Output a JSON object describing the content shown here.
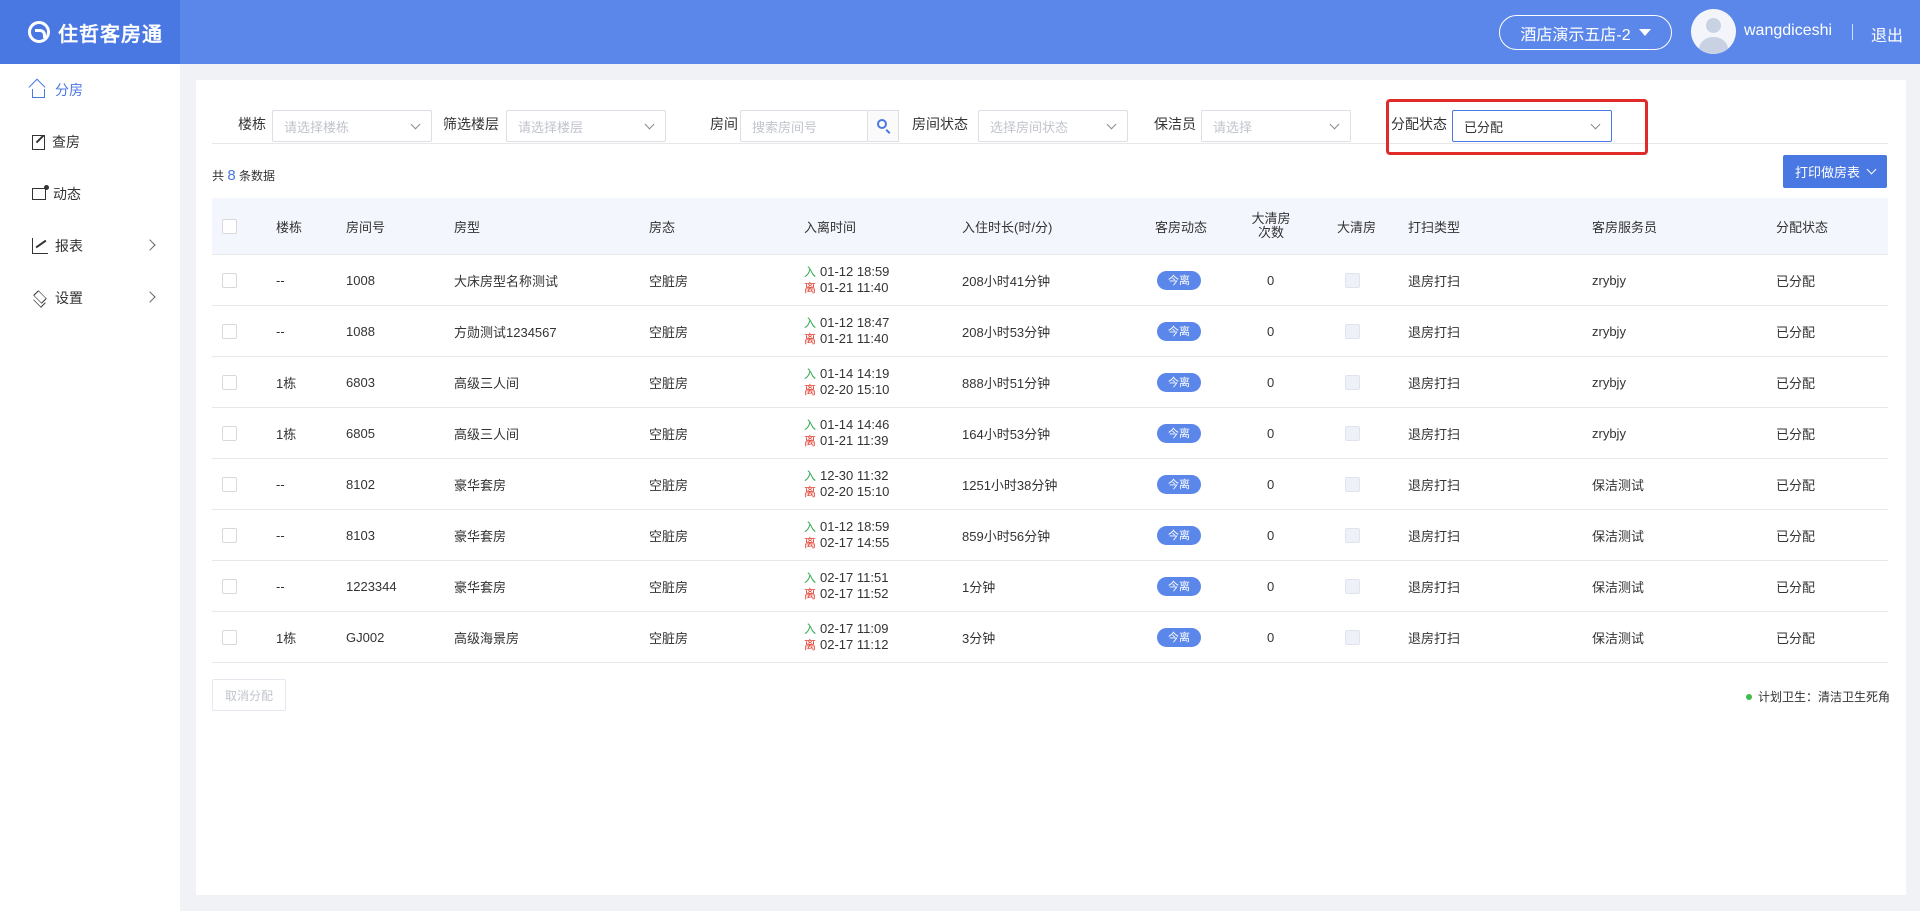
{
  "app": {
    "title": "住哲客房通"
  },
  "header": {
    "store": "酒店演示五店-2",
    "username": "wangdiceshi",
    "logout": "退出"
  },
  "sidebar": {
    "items": [
      {
        "label": "分房",
        "icon": "home-icon",
        "active": true
      },
      {
        "label": "查房",
        "icon": "edit-icon"
      },
      {
        "label": "动态",
        "icon": "dynamic-icon"
      },
      {
        "label": "报表",
        "icon": "chart-icon",
        "has_children": true
      },
      {
        "label": "设置",
        "icon": "layers-icon",
        "has_children": true
      }
    ]
  },
  "filters": {
    "building": {
      "label": "楼栋",
      "placeholder": "请选择楼栋"
    },
    "floor": {
      "label": "筛选楼层",
      "placeholder": "请选择楼层"
    },
    "room": {
      "label": "房间",
      "placeholder": "搜索房间号"
    },
    "room_status": {
      "label": "房间状态",
      "placeholder": "选择房间状态"
    },
    "cleaner": {
      "label": "保洁员",
      "placeholder": "请选择"
    },
    "assign_status": {
      "label": "分配状态",
      "value": "已分配"
    }
  },
  "summary": {
    "prefix": "共",
    "count": "8",
    "suffix": "条数据"
  },
  "toolbar": {
    "print_label": "打印做房表"
  },
  "table": {
    "columns": {
      "building": "楼栋",
      "room_no": "房间号",
      "room_type": "房型",
      "status": "房态",
      "time": "入离时间",
      "duration": "入住时长(时/分)",
      "dynamic": "客房动态",
      "clean_count_1": "大清房",
      "clean_count_2": "次数",
      "deep_clean": "大清房",
      "clean_type": "打扫类型",
      "attendant": "客房服务员",
      "assign": "分配状态"
    },
    "in_label": "入",
    "out_label": "离",
    "rows": [
      {
        "building": "--",
        "room_no": "1008",
        "room_type": "大床房型名称测试",
        "status": "空脏房",
        "in": "01-12 18:59",
        "out": "01-21 11:40",
        "duration": "208小时41分钟",
        "dynamic": "今离",
        "clean_count": "0",
        "clean_type": "退房打扫",
        "attendant": "zrybjy",
        "assign": "已分配"
      },
      {
        "building": "--",
        "room_no": "1088",
        "room_type": "方勋测试1234567",
        "status": "空脏房",
        "in": "01-12 18:47",
        "out": "01-21 11:40",
        "duration": "208小时53分钟",
        "dynamic": "今离",
        "clean_count": "0",
        "clean_type": "退房打扫",
        "attendant": "zrybjy",
        "assign": "已分配"
      },
      {
        "building": "1栋",
        "room_no": "6803",
        "room_type": "高级三人间",
        "status": "空脏房",
        "in": "01-14 14:19",
        "out": "02-20 15:10",
        "duration": "888小时51分钟",
        "dynamic": "今离",
        "clean_count": "0",
        "clean_type": "退房打扫",
        "attendant": "zrybjy",
        "assign": "已分配"
      },
      {
        "building": "1栋",
        "room_no": "6805",
        "room_type": "高级三人间",
        "status": "空脏房",
        "in": "01-14 14:46",
        "out": "01-21 11:39",
        "duration": "164小时53分钟",
        "dynamic": "今离",
        "clean_count": "0",
        "clean_type": "退房打扫",
        "attendant": "zrybjy",
        "assign": "已分配"
      },
      {
        "building": "--",
        "room_no": "8102",
        "room_type": "豪华套房",
        "status": "空脏房",
        "in": "12-30 11:32",
        "out": "02-20 15:10",
        "duration": "1251小时38分钟",
        "dynamic": "今离",
        "clean_count": "0",
        "clean_type": "退房打扫",
        "attendant": "保洁测试",
        "assign": "已分配"
      },
      {
        "building": "--",
        "room_no": "8103",
        "room_type": "豪华套房",
        "status": "空脏房",
        "in": "01-12 18:59",
        "out": "02-17 14:55",
        "duration": "859小时56分钟",
        "dynamic": "今离",
        "clean_count": "0",
        "clean_type": "退房打扫",
        "attendant": "保洁测试",
        "assign": "已分配"
      },
      {
        "building": "--",
        "room_no": "1223344",
        "room_type": "豪华套房",
        "status": "空脏房",
        "in": "02-17 11:51",
        "out": "02-17 11:52",
        "duration": "1分钟",
        "dynamic": "今离",
        "clean_count": "0",
        "clean_type": "退房打扫",
        "attendant": "保洁测试",
        "assign": "已分配"
      },
      {
        "building": "1栋",
        "room_no": "GJ002",
        "room_type": "高级海景房",
        "status": "空脏房",
        "in": "02-17 11:09",
        "out": "02-17 11:12",
        "duration": "3分钟",
        "dynamic": "今离",
        "clean_count": "0",
        "clean_type": "退房打扫",
        "attendant": "保洁测试",
        "assign": "已分配"
      }
    ]
  },
  "footer": {
    "cancel_label": "取消分配",
    "legend": "计划卫生：清洁卫生死角"
  },
  "colors": {
    "header_bg": "#5b87ea",
    "accent": "#4a78e3",
    "highlight": "#e02b2b",
    "in_color": "#33a853",
    "out_color": "#e33b2e"
  }
}
